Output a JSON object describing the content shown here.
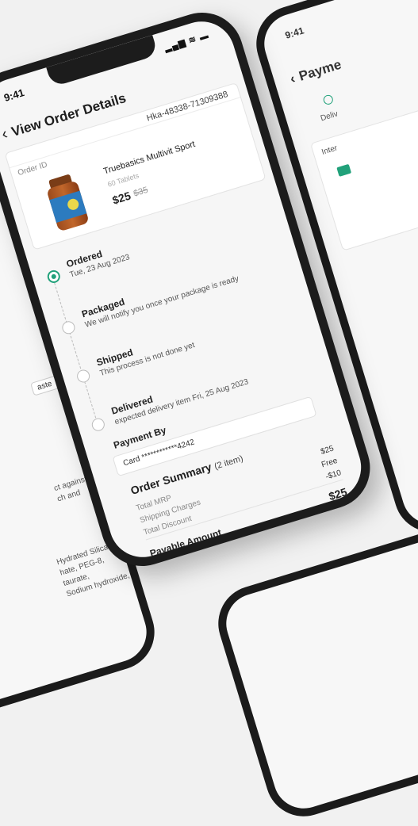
{
  "status_bar": {
    "time": "9:41",
    "icons": "▂▄▆ ≋ ▬"
  },
  "header": {
    "title": "View Order Details"
  },
  "order": {
    "order_number": "Hka-48338-71309388",
    "id_label": "Order ID",
    "product_name": "Truebasics Multivit Sport",
    "quantity": "60 Tablets",
    "price": "$25",
    "mrp": "$35"
  },
  "timeline": [
    {
      "title": "Ordered",
      "subtitle": "Tue, 23 Aug 2023",
      "state": "done"
    },
    {
      "title": "Packaged",
      "subtitle": "We will notify you once your package is ready",
      "state": "pending"
    },
    {
      "title": "Shipped",
      "subtitle": "This process is not done yet",
      "state": "pending"
    },
    {
      "title": "Delivered",
      "subtitle": "expected delivery item Fri, 25 Aug 2023",
      "state": "pending"
    }
  ],
  "payment": {
    "label": "Payment By",
    "card": "Card ************4242"
  },
  "summary": {
    "title": "Order Summary",
    "items": "(2 item)",
    "rows": [
      {
        "label": "Total MRP",
        "value": "$25"
      },
      {
        "label": "Shipping Charges",
        "value": "Free"
      },
      {
        "label": "Total Discount",
        "value": "-$10"
      }
    ],
    "payable_label": "Payable Amount",
    "payable_value": "$25"
  },
  "right_phone": {
    "time": "9:41",
    "title": "Payme",
    "step_label": "Deliv",
    "section": "Inter"
  },
  "left_phone": {
    "button": "aste",
    "text1": "ct against\nch and",
    "text2": "Hydrated Silica,\nhate, PEG-8,\ntaurate,\nSodium hydroxide,"
  },
  "colors": {
    "accent": "#21a17a",
    "phone_frame": "#1c1c1c"
  }
}
